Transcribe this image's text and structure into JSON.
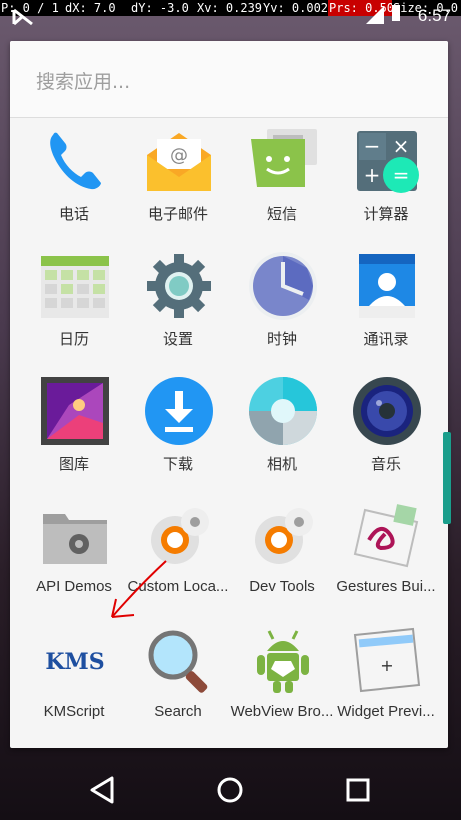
{
  "status_bar": {
    "pointer": {
      "p": "P: 0 / 1",
      "dx": "dX: 7.0",
      "dy": "dY: -3.0",
      "xv": "Xv: 0.239",
      "yv": "Yv: 0.002",
      "prs": "Prs: 0.50",
      "size": "Size: 0.0"
    },
    "time": "6:57"
  },
  "search": {
    "placeholder": "搜索应用..."
  },
  "apps": [
    {
      "label": "电话",
      "icon": "phone-icon"
    },
    {
      "label": "电子邮件",
      "icon": "email-icon"
    },
    {
      "label": "短信",
      "icon": "messaging-icon"
    },
    {
      "label": "计算器",
      "icon": "calculator-icon"
    },
    {
      "label": "日历",
      "icon": "calendar-icon"
    },
    {
      "label": "设置",
      "icon": "settings-icon"
    },
    {
      "label": "时钟",
      "icon": "clock-icon"
    },
    {
      "label": "通讯录",
      "icon": "contacts-icon"
    },
    {
      "label": "图库",
      "icon": "gallery-icon"
    },
    {
      "label": "下载",
      "icon": "download-icon"
    },
    {
      "label": "相机",
      "icon": "camera-icon"
    },
    {
      "label": "音乐",
      "icon": "music-icon"
    },
    {
      "label": "API Demos",
      "icon": "api-demos-icon"
    },
    {
      "label": "Custom Loca...",
      "icon": "custom-locale-icon"
    },
    {
      "label": "Dev Tools",
      "icon": "dev-tools-icon"
    },
    {
      "label": "Gestures Bui...",
      "icon": "gestures-builder-icon"
    },
    {
      "label": "KMScript",
      "icon": "kmscript-icon",
      "icon_text": "KMS"
    },
    {
      "label": "Search",
      "icon": "search-icon"
    },
    {
      "label": "WebView Bro...",
      "icon": "webview-browser-icon"
    },
    {
      "label": "Widget Previ...",
      "icon": "widget-preview-icon"
    }
  ],
  "navigation": {
    "back": "back-icon",
    "home": "home-icon",
    "recents": "recents-icon"
  },
  "colors": {
    "accent": "#1a9e8c",
    "pointer_highlight": "#c80000",
    "annotation": "#e00000"
  }
}
